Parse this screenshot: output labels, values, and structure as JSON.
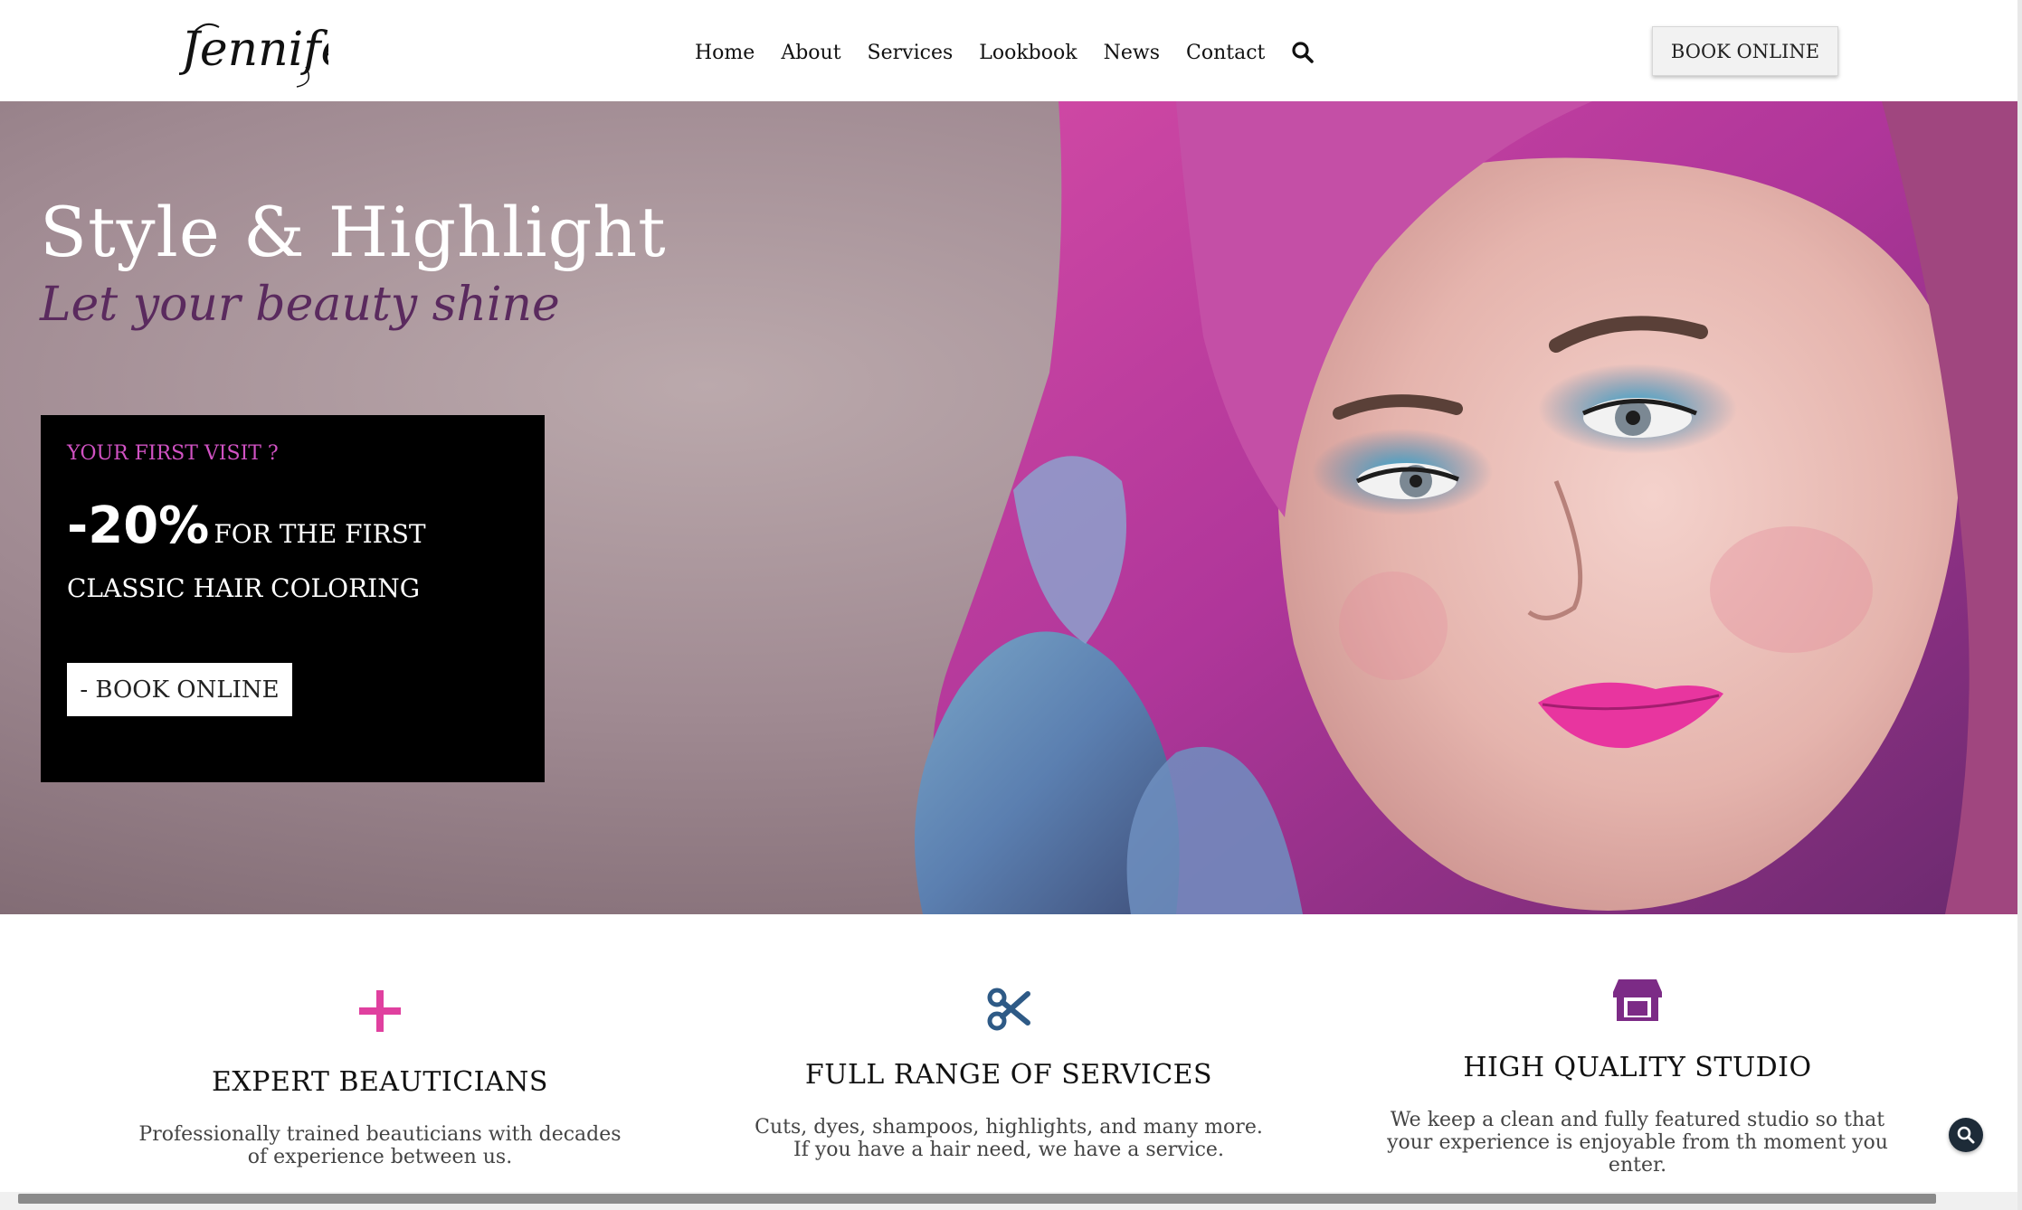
{
  "header": {
    "logo_text": "Jennifer",
    "nav": [
      "Home",
      "About",
      "Services",
      "Lookbook",
      "News",
      "Contact"
    ],
    "search_icon": "search-icon",
    "book_label": "BOOK ONLINE"
  },
  "hero": {
    "title": "Style & Highlight",
    "subtitle": "Let your beauty shine",
    "promo": {
      "eyebrow": "YOUR FIRST VISIT ?",
      "percent": "-20%",
      "offer_text": "FOR THE FIRST CLASSIC HAIR COLORING",
      "button_label": "- BOOK ONLINE"
    }
  },
  "features": [
    {
      "icon": "plus-icon",
      "title": "EXPERT BEAUTICIANS",
      "line1": "Professionally trained beauticians with decades",
      "line2": "of experience between us."
    },
    {
      "icon": "scissors-icon",
      "title": "FULL RANGE OF SERVICES",
      "line1": "Cuts, dyes, shampoos, highlights, and many more.",
      "line2": "If you have a hair need, we have a service."
    },
    {
      "icon": "store-icon",
      "title": "HIGH QUALITY STUDIO",
      "line1": "We keep a clean and fully featured studio so that",
      "line2": "your experience is enjoyable from th moment you",
      "line3": "enter."
    }
  ],
  "colors": {
    "accent_pink": "#e0409f",
    "accent_blue": "#2e5a86",
    "accent_purple": "#7c2b86",
    "promo_eyebrow": "#d152c3",
    "subtitle": "#5a2a5e"
  }
}
